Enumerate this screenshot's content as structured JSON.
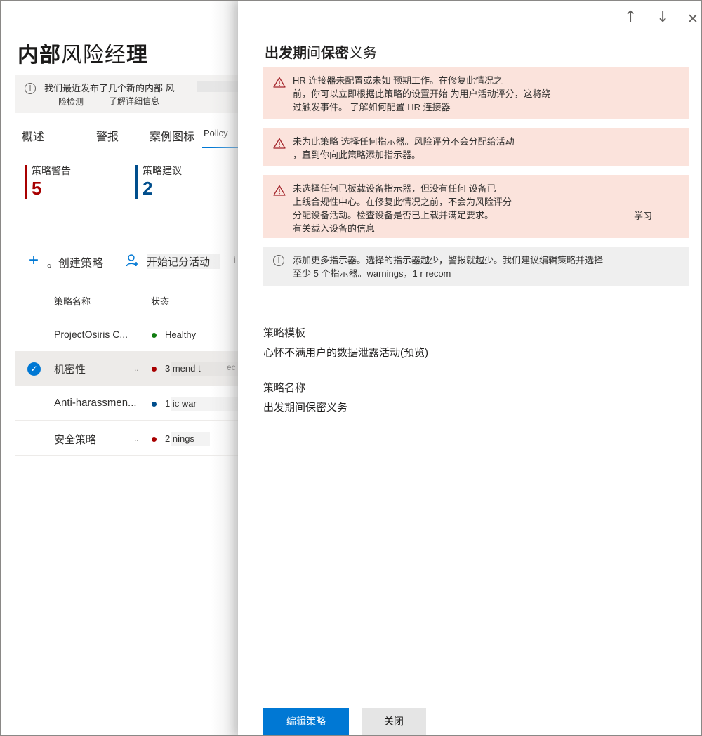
{
  "left": {
    "title_bold_1": "内部",
    "title_light": "风险经",
    "title_bold_2": "理",
    "notice": {
      "line1": "我们最近发布了几个新的内部 风",
      "line2": "险检测",
      "learn_more": "了解详细信息"
    },
    "tabs": [
      {
        "label": "概述"
      },
      {
        "label": "警报"
      },
      {
        "label": "案例图标"
      },
      {
        "label": "Policy"
      }
    ],
    "metrics": [
      {
        "label": "策略警告",
        "value": "5",
        "color": "#a80000"
      },
      {
        "label": "策略建议",
        "value": "2",
        "color": "#004e8c"
      }
    ],
    "commands": {
      "create_prefix": "。",
      "create": "创建策略",
      "start": "开始记分活动",
      "more": "i"
    },
    "columns": {
      "name": "策略名称",
      "status": "状态"
    },
    "rows": [
      {
        "name": "ProjectOsiris C...",
        "dots": "",
        "status": "Healthy",
        "dot_color": "#107c10",
        "extra": ""
      },
      {
        "name": "机密性",
        "dots": "..",
        "status": "3 mend t",
        "dot_color": "#a80000",
        "extra": "ec"
      },
      {
        "name": "Anti-harassmen...",
        "dots": "..",
        "status": "1 ic war",
        "dot_color": "#004e8c",
        "extra": ""
      },
      {
        "name": "安全策略",
        "dots": "..",
        "status": "2 nings",
        "dot_color": "#a80000",
        "extra": ""
      }
    ]
  },
  "panel": {
    "nav": {
      "up": "↑",
      "down": "↓",
      "close": "✕"
    },
    "title_bold_1": "出发期",
    "title_light_1": "间",
    "title_bold_2": "保密",
    "title_light_2": "义务",
    "messages": [
      {
        "type": "warn",
        "lines": [
          "HR 连接器未配置或未如 预期工作。在修复此情况之",
          "前，你可以立即根据此策略的设置开始 为用户活动评分，这将绕",
          "过触发事件。        了解如何配置 HR 连接器"
        ]
      },
      {
        "type": "warn",
        "lines": [
          "未为此策略 选择任何指示器。风险评分不会分配给活动",
          "，直到你向此策略添加指示器。"
        ]
      },
      {
        "type": "warn",
        "lines": [
          "未选择任何已板载设备指示器，但没有任何 设备已",
          "上线合规性中心。在修复此情况之前，不会为风险评分",
          "分配设备活动。检查设备是否已上载并满足要求。",
          "有关载入设备的信息"
        ],
        "learn": "学习"
      },
      {
        "type": "info",
        "lines": [
          "添加更多指示器。选择的指示器越少，警报就越少。我们建议编辑策略并选择",
          "至少 5 个指示器。warnings，1 r recom"
        ]
      }
    ],
    "template_label": "策略模板",
    "template_value": "心怀不满用户的数据泄露活动(预览)",
    "name_label": "策略名称",
    "name_value": "出发期间保密义务",
    "edit_button": "编辑策略",
    "close_button": "关闭"
  }
}
